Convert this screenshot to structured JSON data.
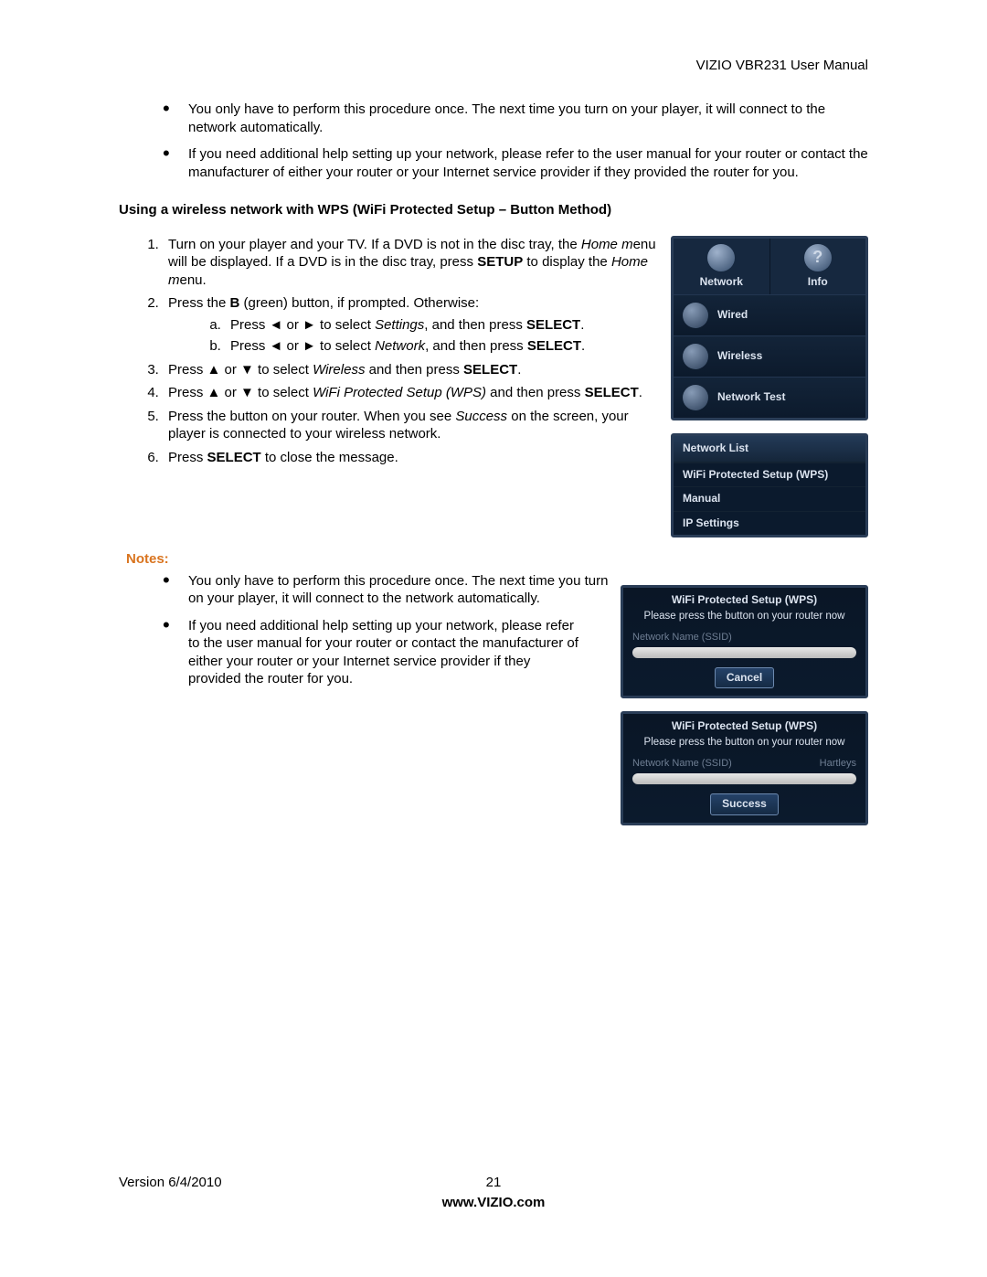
{
  "header": {
    "title": "VIZIO VBR231 User Manual"
  },
  "intro_bullets": [
    "You only have to perform this procedure once. The next time you turn on your player, it will connect to the network automatically.",
    "If you need additional help setting up your network, please refer to the user manual for your router or contact the manufacturer of either your router or your Internet service provider if they provided the router for you."
  ],
  "section_heading": "Using a wireless network with WPS (WiFi Protected Setup – Button Method)",
  "steps": {
    "s1a": "Turn on your player and your TV. If a DVD is not in the disc tray, the ",
    "s1b_italic": "Home m",
    "s1c": "enu will be displayed. If a DVD is in the disc tray, press ",
    "s1d_bold": "SETUP",
    "s1e": " to display the ",
    "s1f_italic": "Home m",
    "s1g": "enu.",
    "s2a": "Press the ",
    "s2b_bold": "B",
    "s2c": " (green) button, if prompted. Otherwise:",
    "s2_sub_a_1": "Press ◄ or ► to select ",
    "s2_sub_a_2_italic": "Settings",
    "s2_sub_a_3": ", and then press ",
    "s2_sub_a_4_bold": "SELECT",
    "s2_sub_a_5": ".",
    "s2_sub_b_1": "Press ◄ or ► to select ",
    "s2_sub_b_2_italic": "Network",
    "s2_sub_b_3": ", and then press ",
    "s2_sub_b_4_bold": "SELECT",
    "s2_sub_b_5": ".",
    "s3a": "Press ▲ or ▼ to select ",
    "s3b_italic": "Wireless",
    "s3c": " and then press ",
    "s3d_bold": "SELECT",
    "s3e": ".",
    "s4a": "Press ▲ or ▼ to select ",
    "s4b_italic": "WiFi Protected Setup (WPS)",
    "s4c": " and then press ",
    "s4d_bold": "SELECT",
    "s4e": ".",
    "s5a": "Press the button on your router. When you see ",
    "s5b_italic": "Success",
    "s5c": " on the screen, your player is connected to your wireless network.",
    "s6a": "Press ",
    "s6b_bold": "SELECT",
    "s6c": " to close the message."
  },
  "notes_label": "Notes:",
  "notes_bullets": {
    "n1": "You only have to perform this procedure once. The next time you turn on your player, it will connect to the network automatically.",
    "n2": "If you need additional help setting up your network, please refer to the user manual for your router or contact the manufacturer of either your router or your Internet service provider if they provided the router for you."
  },
  "ui1": {
    "tab_network": "Network",
    "tab_info": "Info",
    "item_wired": "Wired",
    "item_wireless": "Wireless",
    "item_test": "Network Test"
  },
  "ui2": {
    "hdr": "Network List",
    "r1": "WiFi Protected Setup (WPS)",
    "r2": "Manual",
    "r3": "IP Settings"
  },
  "ui3": {
    "title": "WiFi Protected Setup (WPS)",
    "sub": "Please press the button on your router now",
    "field_label": "Network Name (SSID)",
    "btn": "Cancel"
  },
  "ui4": {
    "title": "WiFi Protected Setup (WPS)",
    "sub": "Please press the button on your router now",
    "field_label": "Network Name (SSID)",
    "field_value": "Hartleys",
    "btn": "Success"
  },
  "footer": {
    "version": "Version 6/4/2010",
    "page": "21",
    "site": "www.VIZIO.com"
  }
}
